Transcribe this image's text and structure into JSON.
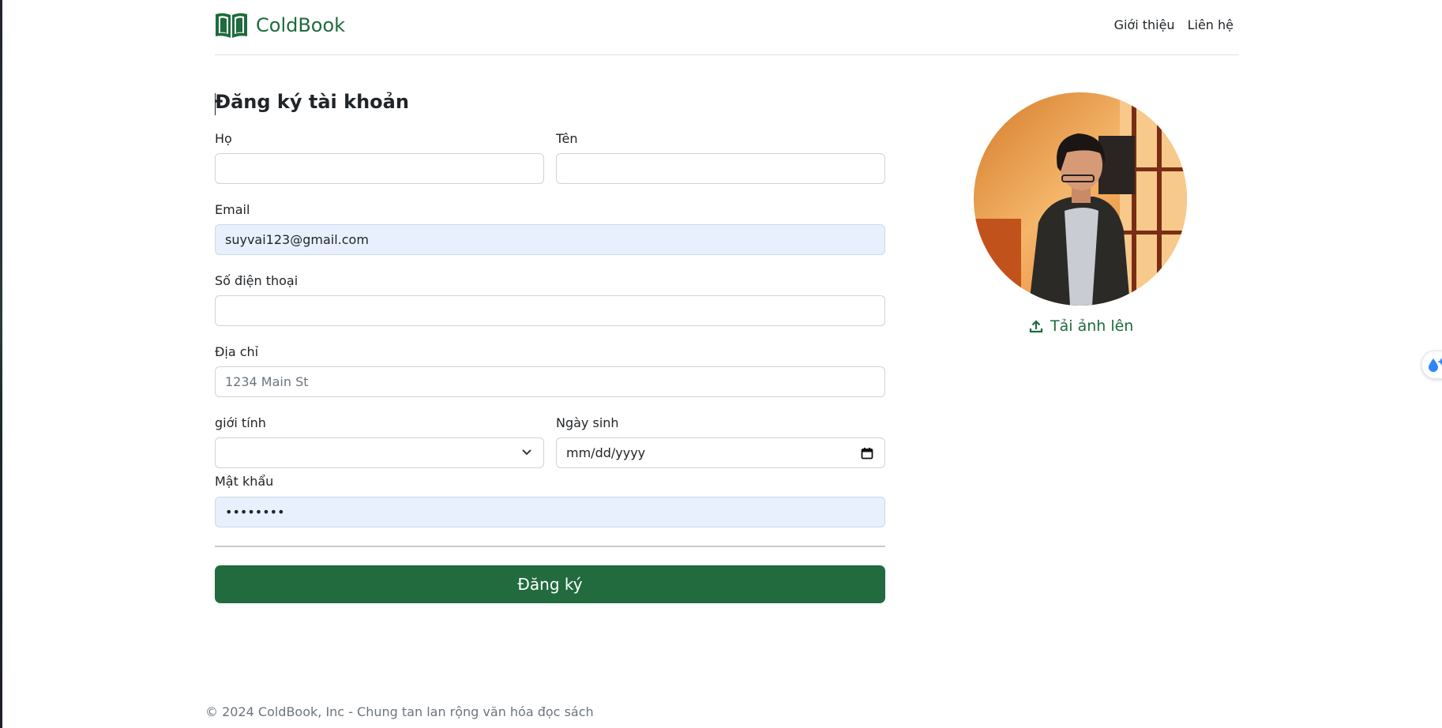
{
  "brand": {
    "name": "ColdBook",
    "icon": "book-icon",
    "color": "#1e6b3d"
  },
  "nav": {
    "items": [
      "Giới thiệu",
      "Liên hệ"
    ]
  },
  "form": {
    "title": "Đăng ký tài khoản",
    "last_name": {
      "label": "Họ",
      "value": ""
    },
    "first_name": {
      "label": "Tên",
      "value": ""
    },
    "email": {
      "label": "Email",
      "value": "suyvai123@gmail.com"
    },
    "phone": {
      "label": "Số điện thoại",
      "value": ""
    },
    "address": {
      "label": "Địa chỉ",
      "placeholder": "1234 Main St"
    },
    "gender": {
      "label": "giới tính",
      "value": ""
    },
    "birthday": {
      "label": "Ngày sinh",
      "placeholder": "mm/dd/yyyy"
    },
    "password": {
      "label": "Mật khẩu",
      "value": "••••••••"
    },
    "submit_label": "Đăng ký",
    "accent_color": "#216b3f"
  },
  "avatar": {
    "upload_label": "Tải ảnh lên",
    "upload_icon": "upload-icon"
  },
  "footer": {
    "text": "© 2024 ColdBook, Inc - Chung tan lan rộng văn hóa đọc sách"
  }
}
